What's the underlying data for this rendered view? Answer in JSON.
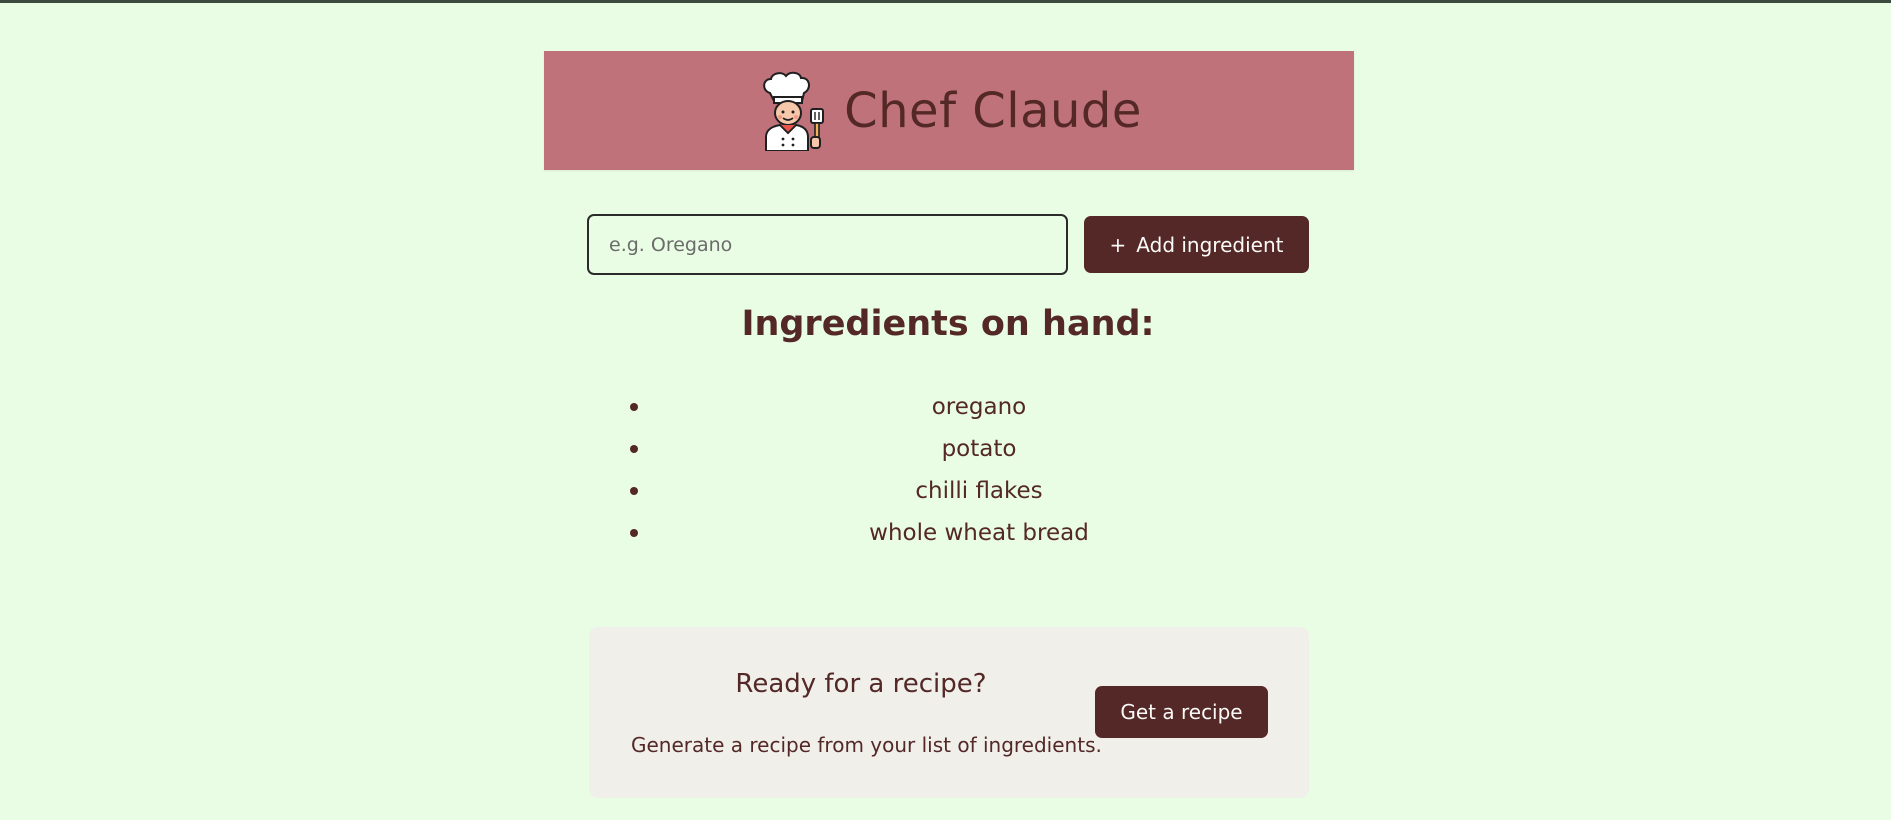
{
  "header": {
    "title": "Chef Claude",
    "logo_icon": "chef-icon"
  },
  "form": {
    "placeholder": "e.g. Oregano",
    "value": "",
    "add_button_icon": "+",
    "add_button_label": "Add ingredient"
  },
  "ingredients": {
    "heading": "Ingredients on hand:",
    "items": [
      "oregano",
      "potato",
      "chilli flakes",
      "whole wheat bread"
    ]
  },
  "recipe_cta": {
    "title": "Ready for a recipe?",
    "description": "Generate a recipe from your list of ingredients.",
    "button_label": "Get a recipe"
  },
  "colors": {
    "background": "#e9fde4",
    "header": "#bf727a",
    "text": "#532826",
    "button": "#532826",
    "card": "#f0efea"
  }
}
